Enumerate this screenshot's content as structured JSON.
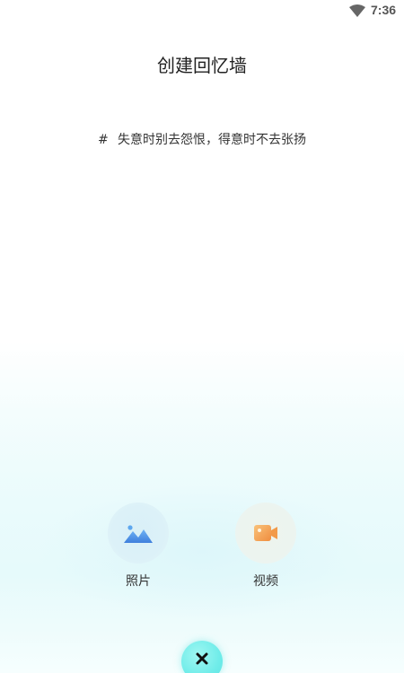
{
  "status_bar": {
    "time": "7:36",
    "wifi_icon": "wifi-icon"
  },
  "title": "创建回忆墙",
  "quote": {
    "hash": "#",
    "text": "失意时别去怨恨，得意时不去张扬"
  },
  "actions": [
    {
      "label": "照片",
      "icon": "image-icon",
      "accent": "#4a90e2"
    },
    {
      "label": "视频",
      "icon": "video-camera-icon",
      "accent": "#f5a25d"
    }
  ],
  "close_button": {
    "icon": "close-icon",
    "color": "#6fece9"
  }
}
